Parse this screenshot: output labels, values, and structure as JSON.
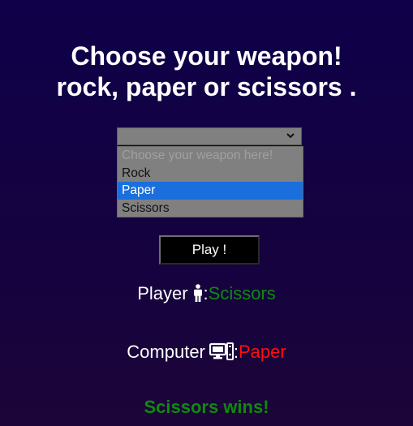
{
  "heading": {
    "line1": "Choose your weapon!",
    "line2": "rock, paper or scissors ."
  },
  "weapon_select": {
    "selected": "",
    "options": [
      "Choose your weapon here!",
      "Rock",
      "Paper",
      "Scissors"
    ],
    "highlighted": "Paper"
  },
  "play_button": {
    "label": "Play !"
  },
  "player": {
    "label": "Player",
    "icon": "person-icon",
    "choice": "Scissors"
  },
  "computer": {
    "label": "Computer",
    "icon": "computer-icon",
    "choice": "Paper"
  },
  "result": {
    "text": "Scissors wins!"
  },
  "colors": {
    "background": "#0f0049",
    "win": "#0e8a0e",
    "lose": "#ff1010",
    "highlight": "#1a6fdc"
  }
}
